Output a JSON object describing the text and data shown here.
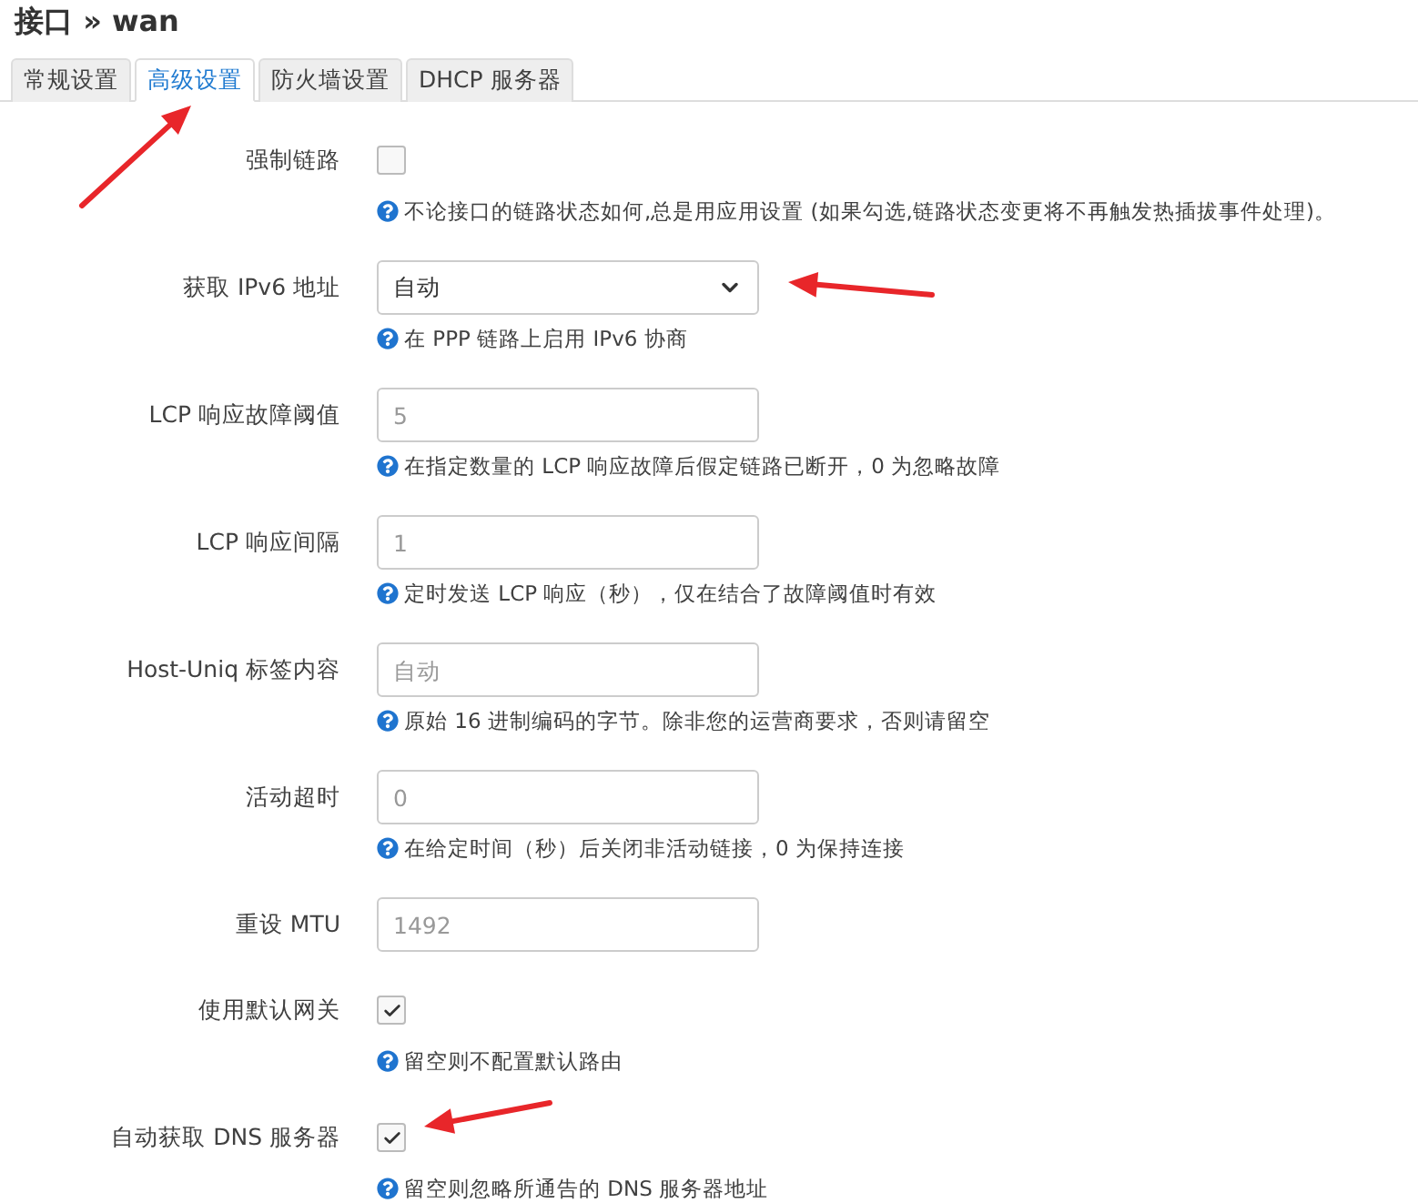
{
  "title": "接口 » wan",
  "tabs": [
    {
      "label": "常规设置",
      "selected": false
    },
    {
      "label": "高级设置",
      "selected": true
    },
    {
      "label": "防火墙设置",
      "selected": false
    },
    {
      "label": "DHCP 服务器",
      "selected": false
    }
  ],
  "fields": [
    {
      "kind": "checkbox",
      "label": "强制链路",
      "checked": false,
      "help": "不论接口的链路状态如何,总是用应用设置 (如果勾选,链路状态变更将不再触发热插拔事件处理)。"
    },
    {
      "kind": "select",
      "label": "获取 IPv6 地址",
      "value": "自动",
      "help": "在 PPP 链路上启用 IPv6 协商"
    },
    {
      "kind": "text",
      "label": "LCP 响应故障阈值",
      "placeholder": "5",
      "help": "在指定数量的 LCP 响应故障后假定链路已断开，0 为忽略故障"
    },
    {
      "kind": "text",
      "label": "LCP 响应间隔",
      "placeholder": "1",
      "help": "定时发送 LCP 响应（秒），仅在结合了故障阈值时有效"
    },
    {
      "kind": "text",
      "label": "Host-Uniq 标签内容",
      "placeholder": "自动",
      "help": "原始 16 进制编码的字节。除非您的运营商要求，否则请留空"
    },
    {
      "kind": "text",
      "label": "活动超时",
      "placeholder": "0",
      "help": "在给定时间（秒）后关闭非活动链接，0 为保持连接"
    },
    {
      "kind": "text",
      "label": "重设 MTU",
      "placeholder": "1492"
    },
    {
      "kind": "checkbox",
      "label": "使用默认网关",
      "checked": true,
      "help": "留空则不配置默认路由"
    },
    {
      "kind": "checkbox",
      "label": "自动获取 DNS 服务器",
      "checked": true,
      "help": "留空则忽略所通告的 DNS 服务器地址"
    }
  ]
}
